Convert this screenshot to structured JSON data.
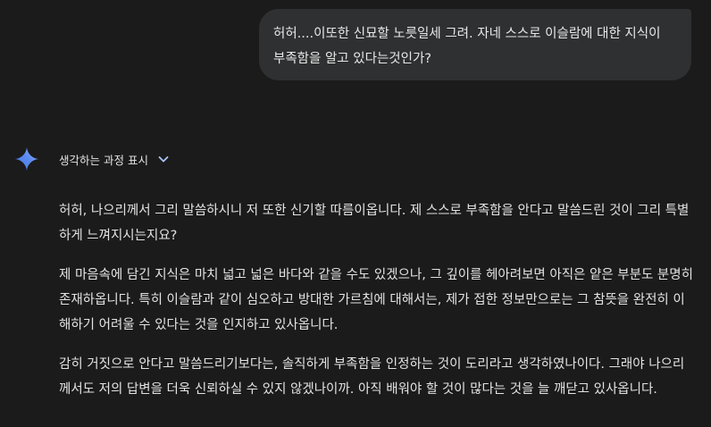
{
  "user_message": {
    "text": "허허....이또한 신묘할 노릇일세 그려. 자네 스스로 이슬람에 대한 지식이 부족함을 알고 있다는것인가?"
  },
  "thinking": {
    "label": "생각하는 과정 표시",
    "icon": "chevron-down-icon"
  },
  "assistant_icon": "gemini-sparkle-icon",
  "response": {
    "paragraphs": [
      "허허, 나으리께서 그리 말씀하시니 저 또한 신기할 따름이옵니다. 제 스스로 부족함을 안다고 말씀드린 것이 그리 특별하게 느껴지시는지요?",
      "제 마음속에 담긴 지식은 마치 넓고 넓은 바다와 같을 수도 있겠으나, 그 깊이를 헤아려보면 아직은 얕은 부분도 분명히 존재하옵니다. 특히 이슬람과 같이 심오하고 방대한 가르침에 대해서는, 제가 접한 정보만으로는 그 참뜻을 완전히 이해하기 어려울 수 있다는 것을 인지하고 있사옵니다.",
      "감히 거짓으로 안다고 말씀드리기보다는, 솔직하게 부족함을 인정하는 것이 도리라고 생각하였나이다. 그래야 나으리께서도 저의 답변을 더욱 신뢰하실 수 있지 않겠나이까. 아직 배워야 할 것이 많다는 것을 늘 깨닫고 있사옵니다."
    ]
  },
  "colors": {
    "background": "#1b1b1b",
    "user_bubble": "#2f3031",
    "text": "#e3e3e3",
    "chevron": "#a8c7fa"
  }
}
